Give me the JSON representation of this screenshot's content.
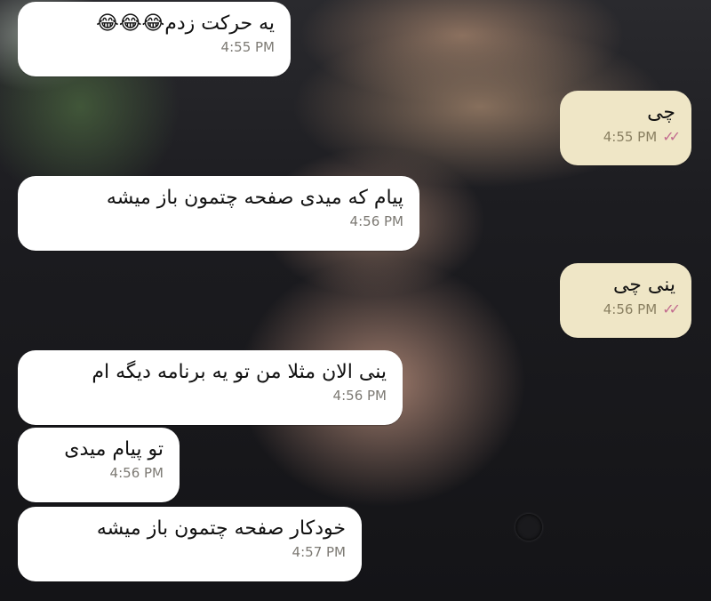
{
  "chat": {
    "messages": [
      {
        "direction": "incoming",
        "text": "یه حرکت زدم😂😂😂",
        "time": "4:55 PM"
      },
      {
        "direction": "outgoing",
        "text": "چی",
        "time": "4:55 PM",
        "status": "read"
      },
      {
        "direction": "incoming",
        "text": "پیام که میدی صفحه چتمون باز میشه",
        "time": "4:56 PM"
      },
      {
        "direction": "outgoing",
        "text": "ینی چی",
        "time": "4:56 PM",
        "status": "read"
      },
      {
        "direction": "incoming",
        "text": "ینی الان مثلا من تو یه برنامه دیگه ام",
        "time": "4:56 PM"
      },
      {
        "direction": "incoming",
        "text": "تو پیام میدی",
        "time": "4:56 PM"
      },
      {
        "direction": "incoming",
        "text": "خودکار صفحه چتمون باز میشه",
        "time": "4:57 PM"
      }
    ],
    "read_icon": "double-check-icon",
    "colors": {
      "incoming_bubble": "#ffffff",
      "outgoing_bubble": "#efe6c6",
      "read_check": "#c26b8f"
    }
  }
}
